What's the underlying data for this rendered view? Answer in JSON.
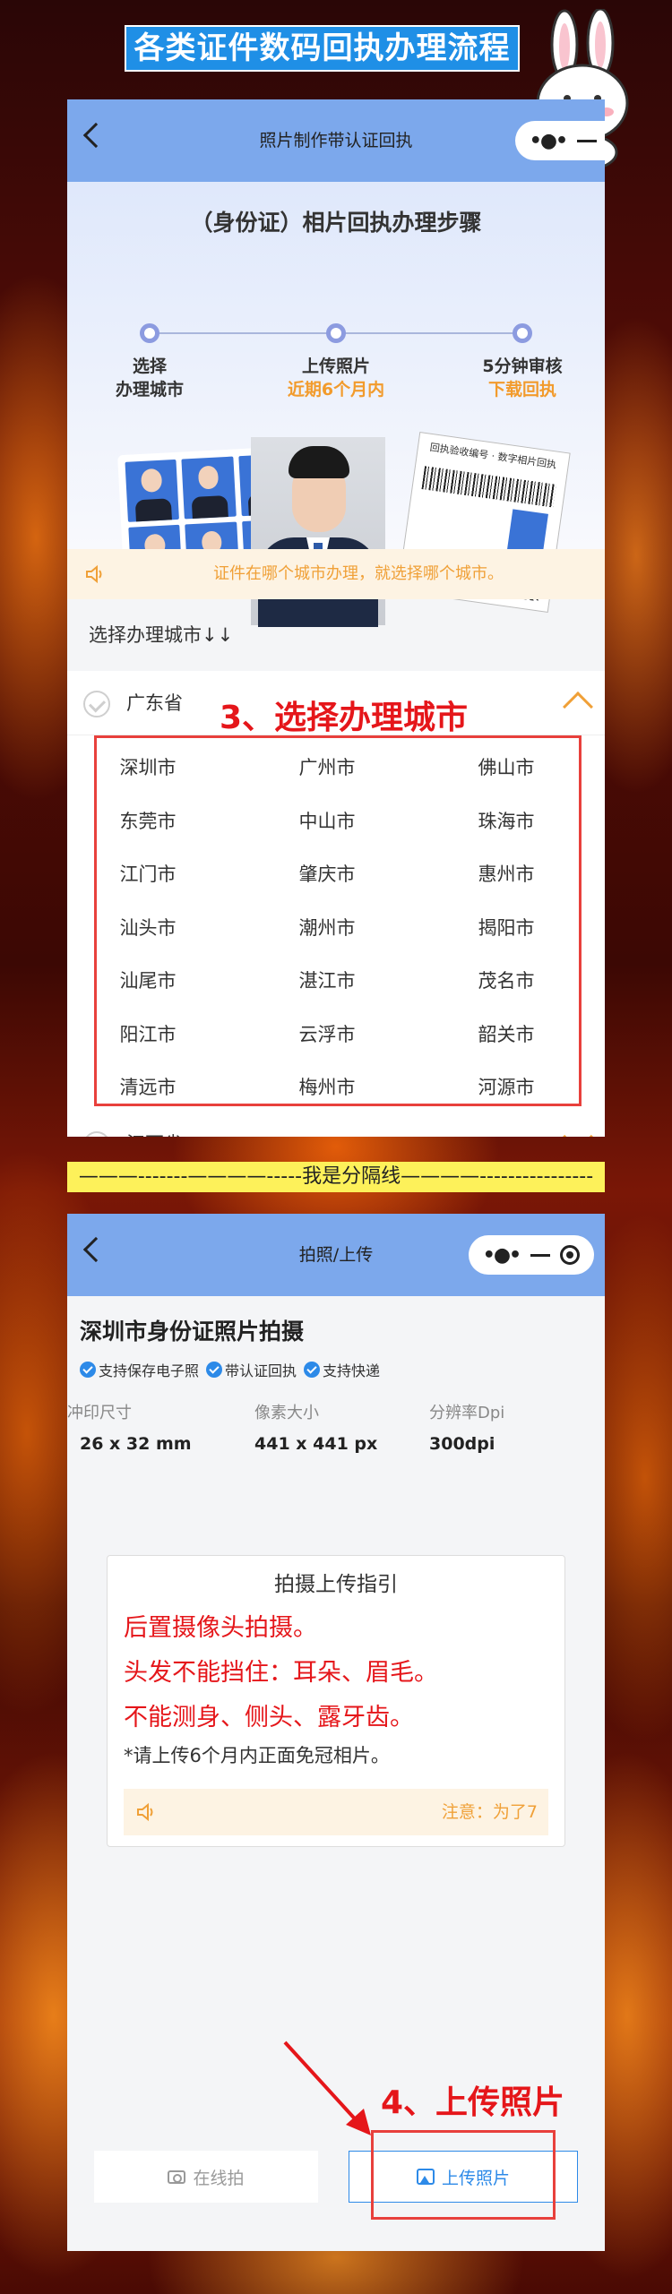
{
  "header": {
    "title": "各类证件数码回执办理流程"
  },
  "panel1": {
    "nav_title": "照片制作带认证回执",
    "steps_title": "（身份证）相片回执办理步骤",
    "steps": [
      {
        "label": "选择",
        "sub": "办理城市"
      },
      {
        "label": "上传照片",
        "sub": "近期6个月内"
      },
      {
        "label": "5分钟审核",
        "sub": "下载回执"
      }
    ],
    "receipt_header": "回执验收编号 · 数字相片回执",
    "notice": "证件在哪个城市办理，就选择哪个城市。",
    "select_label": "选择办理城市↓↓",
    "province_1": "广东省",
    "province_2": "江西省",
    "cities": [
      "深圳市",
      "广州市",
      "佛山市",
      "东莞市",
      "中山市",
      "珠海市",
      "江门市",
      "肇庆市",
      "惠州市",
      "汕头市",
      "潮州市",
      "揭阳市",
      "汕尾市",
      "湛江市",
      "茂名市",
      "阳江市",
      "云浮市",
      "韶关市",
      "清远市",
      "梅州市",
      "河源市"
    ],
    "annotation": "3、选择办理城市"
  },
  "divider": "———-------————-----我是分隔线————----------------",
  "panel2": {
    "nav_title": "拍照/上传",
    "title": "深圳市身份证照片拍摄",
    "badges": [
      "支持保存电子照",
      "带认证回执",
      "支持快递"
    ],
    "spec_headers": [
      "冲印尺寸",
      "像素大小",
      "分辨率Dpi"
    ],
    "spec_values": [
      "26 x 32 mm",
      "441 x 441 px",
      "300dpi"
    ],
    "guide_title": "拍摄上传指引",
    "guide_red": [
      "后置摄像头拍摄。",
      "头发不能挡住：耳朵、眉毛。",
      "不能测身、侧头、露牙齿。"
    ],
    "guide_note": "*请上传6个月内正面免冠相片。",
    "guide_notice": "注意：为了7",
    "btn_online": "在线拍",
    "btn_upload": "上传照片",
    "annotation": "4、上传照片"
  },
  "colors": {
    "nav_blue": "#7ca8ec",
    "accent_orange": "#f0a037",
    "annot_red": "#e5161a",
    "link_blue": "#2d8ae8"
  }
}
